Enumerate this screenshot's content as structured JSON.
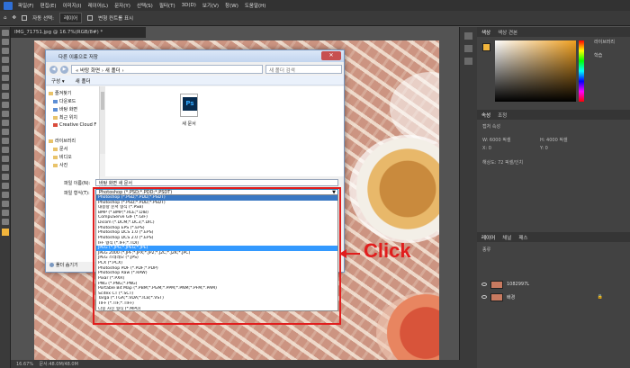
{
  "menubar": {
    "items": [
      "파일(F)",
      "편집(E)",
      "이미지(I)",
      "레이어(L)",
      "문자(Y)",
      "선택(S)",
      "필터(T)",
      "3D(D)",
      "보기(V)",
      "창(W)",
      "도움말(H)"
    ]
  },
  "options": {
    "auto_select": "자동 선택:",
    "layer_dd": "레이어",
    "transform": "변형 컨트롤 표시"
  },
  "document": {
    "tab_title": "IMG_71751.jpg @ 16.7%(RGB/8#) *",
    "zoom": "16.67%",
    "status": "문서:48.0M/48.0M"
  },
  "panels": {
    "color_tabs": [
      "색상",
      "색상 견본"
    ],
    "libraries": "라이브러리",
    "libraries_sub": "학습",
    "props_tabs": [
      "속성",
      "조정"
    ],
    "props_label": "캡처 속성",
    "w": "W: 6000 픽셀",
    "h": "H: 4000 픽셀",
    "x": "X: 0",
    "y": "Y: 0",
    "resolution": "해상도: 72 픽셀/인치",
    "layers_tabs": [
      "레이어",
      "채널",
      "패스"
    ],
    "kind": "종류",
    "layers": [
      {
        "name": "1082997L"
      },
      {
        "name": "배경"
      }
    ]
  },
  "dialog": {
    "title": "다른 이름으로 저장",
    "close": "✕",
    "path": "« 바탕 화면 › 새 폴더 ›",
    "search_placeholder": "새 폴더 검색",
    "organize": "구성 ▾",
    "new_folder": "새 폴더",
    "nav": {
      "favorites": "즐겨찾기",
      "downloads": "다운로드",
      "desktop": "바탕 화면",
      "recent": "최근 위치",
      "creative_cloud": "Creative Cloud F",
      "library": "라이브러리",
      "documents": "문서",
      "videos": "비디오",
      "pictures": "사진"
    },
    "file": {
      "icon_text": "Ps",
      "name": "새 문서"
    },
    "filename_label": "파일 이름(N):",
    "filename_value": "바탕 화면 새 문서",
    "filetype_label": "파일 형식(T):",
    "filetype_value": "Photoshop (*.PSD;*.PDD;*.PSDT)",
    "hide_folders": "폴더 숨기기"
  },
  "filetypes": [
    "Photoshop (*.PSD;*.PDD;*.PSDT)",
    "Photoshop (*.PSD;*.PDD;*.PSDT)",
    "대용량 문서 형식 (*.PSB)",
    "BMP (*.BMP;*.RLE;*.DIB)",
    "CompuServe GIF (*.GIF)",
    "Dicom (*.DCM;*.DC3;*.DIC)",
    "Photoshop EPS (*.EPS)",
    "Photoshop DCS 1.0 (*.EPS)",
    "Photoshop DCS 2.0 (*.EPS)",
    "IFF 형식 (*.IFF;*.TDI)",
    "JPEG (*.JPG;*.JPEG;*.JPE)",
    "JPEG 2000 (*.JPF;*.JPX;*.JP2;*.J2C;*.J2K;*.JPC)",
    "JPEG 스테레오 (*.JPS)",
    "PCX (*.PCX)",
    "Photoshop PDF (*.PDF;*.PDP)",
    "Photoshop Raw (*.RAW)",
    "Pixar (*.PXR)",
    "PNG (*.PNG;*.PNG)",
    "Portable Bit Map (*.PBM;*.PGM;*.PPM;*.PNM;*.PFM;*.PAM)",
    "Scitex CT (*.SCT)",
    "Targa (*.TGA;*.VDA;*.ICB;*.VST)",
    "TIFF (*.TIF;*.TIFF)",
    "다중 사진 형식 (*.MPO)"
  ],
  "filetypes_selected_index": 10,
  "annotation": {
    "label": "Click"
  },
  "colors": {
    "accent_red": "#e11d1d",
    "foreground": "#f2b53c",
    "selection": "#3399ff"
  }
}
